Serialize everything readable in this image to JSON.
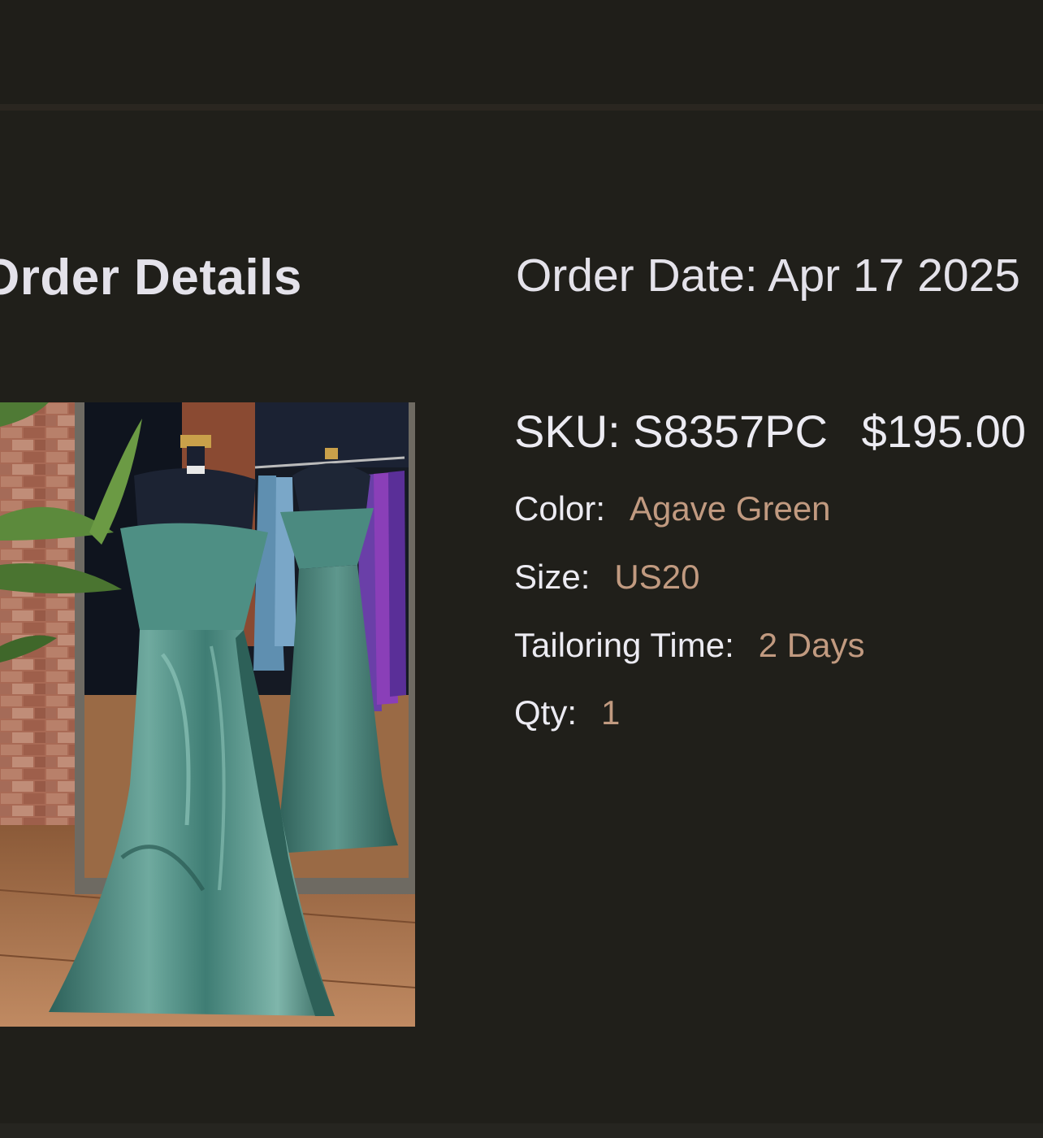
{
  "header": {
    "title": "Order Details",
    "order_date": "Order Date: Apr 17 2025"
  },
  "item": {
    "image_alt": "Agave Green off-shoulder satin gown with lace corset bodice",
    "sku": "SKU: S8357PC",
    "price": "$195.00",
    "details": [
      {
        "label": "Color:",
        "value": "Agave Green"
      },
      {
        "label": "Size:",
        "value": "US20"
      },
      {
        "label": "Tailoring Time:",
        "value": "2 Days"
      },
      {
        "label": "Qty:",
        "value": "1"
      }
    ]
  },
  "colors": {
    "background": "#201f1a",
    "text": "#e4e2ea",
    "accent": "#c19a80",
    "dress": "#3f7d74"
  }
}
